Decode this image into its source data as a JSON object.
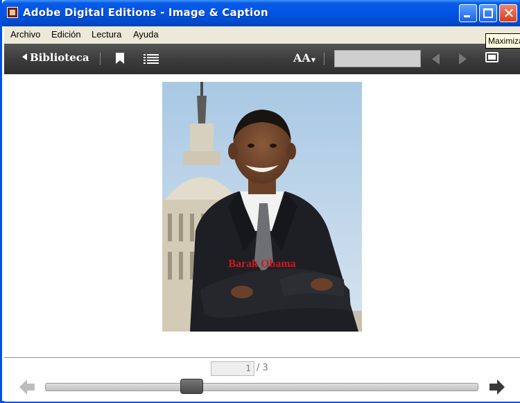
{
  "window": {
    "title": "Adobe Digital Editions - Image & Caption",
    "close_glyph": "✕"
  },
  "menu": {
    "items": [
      "Archivo",
      "Edición",
      "Lectura",
      "Ayuda"
    ]
  },
  "tooltip": {
    "text": "Maximizar"
  },
  "toolbar": {
    "library_label": "Biblioteca",
    "font_size_label": "AA",
    "search_value": ""
  },
  "content": {
    "caption": "Barak Obama",
    "caption_color": "#d2161c"
  },
  "pagination": {
    "current_page": "1",
    "total_label": "/ 3",
    "progress_fraction": 0.333
  },
  "icons": {
    "app": "adobe-digital-editions-icon",
    "bookmark": "bookmark-icon",
    "toc": "table-of-contents-icon",
    "font": "font-size-icon",
    "prev": "previous-page-icon",
    "next": "next-page-icon",
    "fullscreen": "fullscreen-icon",
    "back": "back-arrow-icon",
    "forward": "forward-arrow-icon"
  }
}
